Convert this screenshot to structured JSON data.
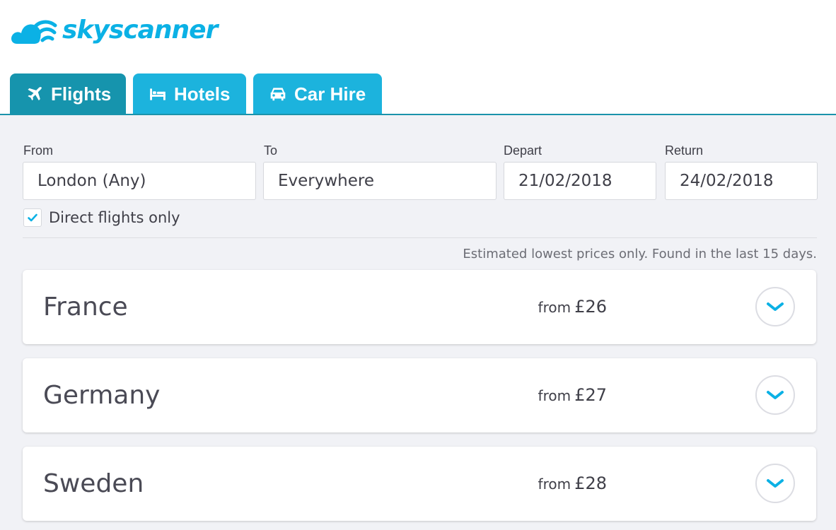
{
  "brand": {
    "name": "skyscanner",
    "color": "#0bb1e5"
  },
  "tabs": [
    {
      "label": "Flights",
      "icon": "plane-icon",
      "active": true
    },
    {
      "label": "Hotels",
      "icon": "bed-icon",
      "active": false
    },
    {
      "label": "Car Hire",
      "icon": "car-icon",
      "active": false
    }
  ],
  "search": {
    "from_label": "From",
    "from_value": "London (Any)",
    "to_label": "To",
    "to_value": "Everywhere",
    "depart_label": "Depart",
    "depart_value": "21/02/2018",
    "return_label": "Return",
    "return_value": "24/02/2018",
    "direct_label": "Direct flights only",
    "direct_checked": true
  },
  "note": "Estimated lowest prices only. Found in the last 15 days.",
  "results": [
    {
      "country": "France",
      "from_label": "from",
      "price": "£26"
    },
    {
      "country": "Germany",
      "from_label": "from",
      "price": "£27"
    },
    {
      "country": "Sweden",
      "from_label": "from",
      "price": "£28"
    }
  ],
  "colors": {
    "tab_active": "#1694ad",
    "tab_inactive": "#1cb3dd",
    "accent": "#0bb1e5",
    "background": "#f1f2f6"
  }
}
